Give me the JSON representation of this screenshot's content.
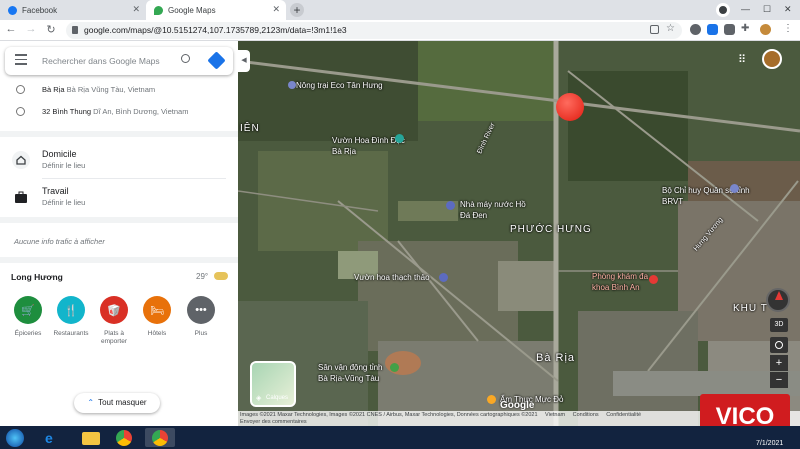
{
  "browser": {
    "tabs": [
      {
        "title": "Facebook",
        "active": false
      },
      {
        "title": "Google Maps",
        "active": true
      }
    ],
    "url": "google.com/maps/@10.5151274,107.1735789,2123m/data=!3m1!1e3"
  },
  "panel": {
    "search_placeholder": "Rechercher dans Google Maps",
    "recents": [
      {
        "main": "Bà Rịa",
        "sub": "Bà Rịa Vũng Tàu, Vietnam"
      },
      {
        "main": "32 Bình Thung",
        "sub": "Dĩ An, Bình Dương, Vietnam"
      }
    ],
    "places": [
      {
        "title": "Domicile",
        "sub": "Définir le lieu",
        "icon": "home-icon"
      },
      {
        "title": "Travail",
        "sub": "Définir le lieu",
        "icon": "briefcase-icon"
      }
    ],
    "traffic": "Aucune info trafic à afficher",
    "weather": {
      "location": "Long Hương",
      "temp": "29°"
    },
    "categories": [
      {
        "label": "Épiceries",
        "color": "#1e8e3e",
        "icon": "cart-icon"
      },
      {
        "label": "Restaurants",
        "color": "#12b5cb",
        "icon": "fork-knife-icon"
      },
      {
        "label": "Plats à emporter",
        "color": "#d93025",
        "icon": "takeout-icon"
      },
      {
        "label": "Hôtels",
        "color": "#e8710a",
        "icon": "bed-icon"
      },
      {
        "label": "Plus",
        "color": "#5f6368",
        "icon": "more-icon"
      }
    ],
    "hide_all": "Tout masquer"
  },
  "map": {
    "labels": [
      "Nông trại Eco Tân Hưng",
      "Vườn Hoa Đình Đặc Bà Rịa",
      "Đình River",
      "Nhà máy nước Hồ Đá Đen",
      "PHƯỚC HƯNG",
      "Vườn hoa thạch thảo",
      "Bộ Chỉ huy Quân sự tỉnh BRVT",
      "Phòng khám đa khoa Bình An",
      "Sân vận động tỉnh Bà Rịa-Vũng Tàu",
      "Bà Rịa",
      "Ẩm Thực Mực Đỏ",
      "Hưng Vương",
      "KHU T",
      "IÊN"
    ],
    "layer_label": "Calques",
    "attribution": "Images ©2021 Maxar Technologies, Images ©2021 CNES / Airbus, Maxar Technologies, Données cartographiques ©2021",
    "feedback": "Envoyer des commentaires",
    "google": "Google",
    "vietnam": "Vietnam",
    "terms": "Conditions",
    "privacy": "Confidentialité",
    "view_3d": "3D",
    "zoom_in": "+",
    "zoom_out": "−"
  },
  "watermark": "VICO",
  "taskbar": {
    "date": "7/1/2021"
  }
}
